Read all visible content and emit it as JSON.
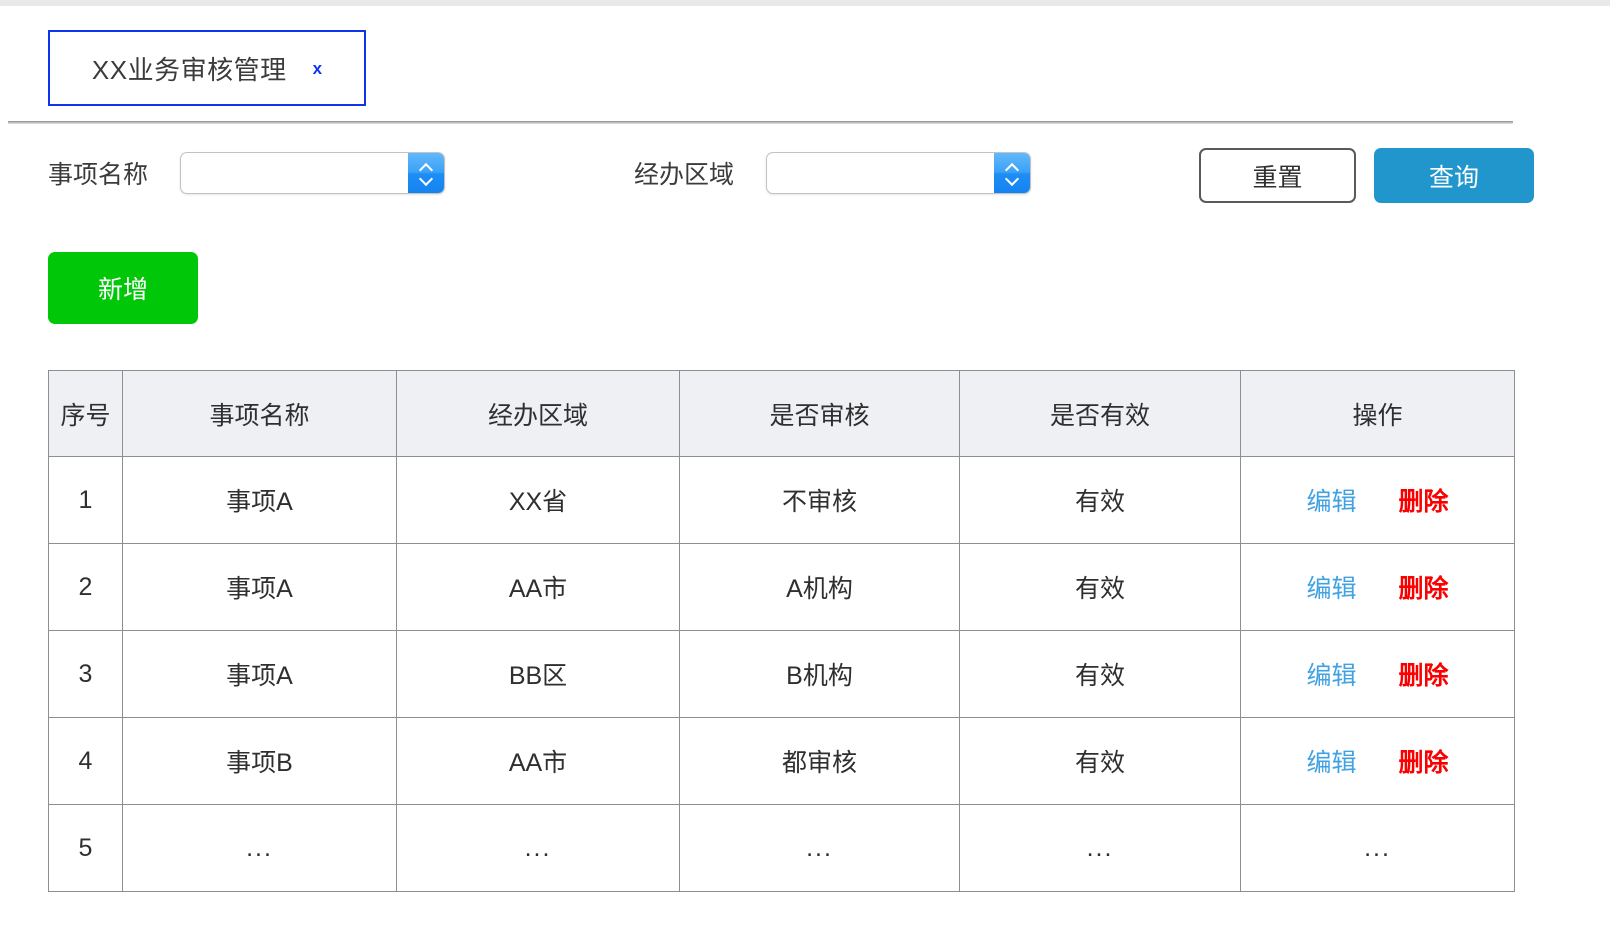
{
  "tab": {
    "label": "XX业务审核管理",
    "close_icon": "x"
  },
  "filters": [
    {
      "label": "事项名称",
      "value": "",
      "placeholder": "",
      "icon": "chevron-updown-icon"
    },
    {
      "label": "经办区域",
      "value": "",
      "placeholder": "",
      "icon": "chevron-updown-icon"
    }
  ],
  "buttons": {
    "reset": "重置",
    "query": "查询",
    "add": "新增"
  },
  "colors": {
    "tab_border": "#1133ee",
    "query_blue": "#2196cd",
    "add_green": "#00c708",
    "edit_blue": "#41a2e2",
    "delete_red": "#fb0000",
    "header_bg": "#eff0f4",
    "select_arrow_blue": "#1e8ef5"
  },
  "table": {
    "headers": [
      "序号",
      "事项名称",
      "经办区域",
      "是否审核",
      "是否有效",
      "操作"
    ],
    "rows": [
      {
        "index": "1",
        "name": "事项A",
        "area": "XX省",
        "audit": "不审核",
        "valid": "有效",
        "edit": "编辑",
        "delete": "删除"
      },
      {
        "index": "2",
        "name": "事项A",
        "area": "AA市",
        "audit": "A机构",
        "valid": "有效",
        "edit": "编辑",
        "delete": "删除"
      },
      {
        "index": "3",
        "name": "事项A",
        "area": "BB区",
        "audit": "B机构",
        "valid": "有效",
        "edit": "编辑",
        "delete": "删除"
      },
      {
        "index": "4",
        "name": "事项B",
        "area": "AA市",
        "audit": "都审核",
        "valid": "有效",
        "edit": "编辑",
        "delete": "删除"
      },
      {
        "index": "5",
        "name": "...",
        "area": "...",
        "audit": "...",
        "valid": "...",
        "ops": "..."
      }
    ]
  }
}
